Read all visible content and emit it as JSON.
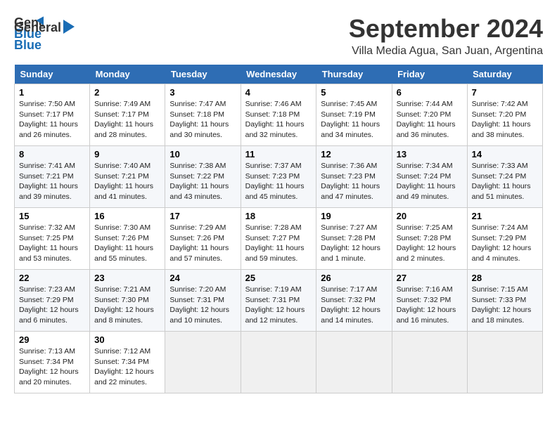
{
  "header": {
    "logo_general": "General",
    "logo_blue": "Blue",
    "month_title": "September 2024",
    "location": "Villa Media Agua, San Juan, Argentina"
  },
  "calendar": {
    "days_of_week": [
      "Sunday",
      "Monday",
      "Tuesday",
      "Wednesday",
      "Thursday",
      "Friday",
      "Saturday"
    ],
    "weeks": [
      [
        null,
        {
          "day": "2",
          "sunrise": "Sunrise: 7:49 AM",
          "sunset": "Sunset: 7:17 PM",
          "daylight": "Daylight: 11 hours and 28 minutes."
        },
        {
          "day": "3",
          "sunrise": "Sunrise: 7:47 AM",
          "sunset": "Sunset: 7:18 PM",
          "daylight": "Daylight: 11 hours and 30 minutes."
        },
        {
          "day": "4",
          "sunrise": "Sunrise: 7:46 AM",
          "sunset": "Sunset: 7:18 PM",
          "daylight": "Daylight: 11 hours and 32 minutes."
        },
        {
          "day": "5",
          "sunrise": "Sunrise: 7:45 AM",
          "sunset": "Sunset: 7:19 PM",
          "daylight": "Daylight: 11 hours and 34 minutes."
        },
        {
          "day": "6",
          "sunrise": "Sunrise: 7:44 AM",
          "sunset": "Sunset: 7:20 PM",
          "daylight": "Daylight: 11 hours and 36 minutes."
        },
        {
          "day": "7",
          "sunrise": "Sunrise: 7:42 AM",
          "sunset": "Sunset: 7:20 PM",
          "daylight": "Daylight: 11 hours and 38 minutes."
        }
      ],
      [
        {
          "day": "1",
          "sunrise": "Sunrise: 7:50 AM",
          "sunset": "Sunset: 7:17 PM",
          "daylight": "Daylight: 11 hours and 26 minutes."
        },
        null,
        null,
        null,
        null,
        null,
        null
      ],
      [
        {
          "day": "8",
          "sunrise": "Sunrise: 7:41 AM",
          "sunset": "Sunset: 7:21 PM",
          "daylight": "Daylight: 11 hours and 39 minutes."
        },
        {
          "day": "9",
          "sunrise": "Sunrise: 7:40 AM",
          "sunset": "Sunset: 7:21 PM",
          "daylight": "Daylight: 11 hours and 41 minutes."
        },
        {
          "day": "10",
          "sunrise": "Sunrise: 7:38 AM",
          "sunset": "Sunset: 7:22 PM",
          "daylight": "Daylight: 11 hours and 43 minutes."
        },
        {
          "day": "11",
          "sunrise": "Sunrise: 7:37 AM",
          "sunset": "Sunset: 7:23 PM",
          "daylight": "Daylight: 11 hours and 45 minutes."
        },
        {
          "day": "12",
          "sunrise": "Sunrise: 7:36 AM",
          "sunset": "Sunset: 7:23 PM",
          "daylight": "Daylight: 11 hours and 47 minutes."
        },
        {
          "day": "13",
          "sunrise": "Sunrise: 7:34 AM",
          "sunset": "Sunset: 7:24 PM",
          "daylight": "Daylight: 11 hours and 49 minutes."
        },
        {
          "day": "14",
          "sunrise": "Sunrise: 7:33 AM",
          "sunset": "Sunset: 7:24 PM",
          "daylight": "Daylight: 11 hours and 51 minutes."
        }
      ],
      [
        {
          "day": "15",
          "sunrise": "Sunrise: 7:32 AM",
          "sunset": "Sunset: 7:25 PM",
          "daylight": "Daylight: 11 hours and 53 minutes."
        },
        {
          "day": "16",
          "sunrise": "Sunrise: 7:30 AM",
          "sunset": "Sunset: 7:26 PM",
          "daylight": "Daylight: 11 hours and 55 minutes."
        },
        {
          "day": "17",
          "sunrise": "Sunrise: 7:29 AM",
          "sunset": "Sunset: 7:26 PM",
          "daylight": "Daylight: 11 hours and 57 minutes."
        },
        {
          "day": "18",
          "sunrise": "Sunrise: 7:28 AM",
          "sunset": "Sunset: 7:27 PM",
          "daylight": "Daylight: 11 hours and 59 minutes."
        },
        {
          "day": "19",
          "sunrise": "Sunrise: 7:27 AM",
          "sunset": "Sunset: 7:28 PM",
          "daylight": "Daylight: 12 hours and 1 minute."
        },
        {
          "day": "20",
          "sunrise": "Sunrise: 7:25 AM",
          "sunset": "Sunset: 7:28 PM",
          "daylight": "Daylight: 12 hours and 2 minutes."
        },
        {
          "day": "21",
          "sunrise": "Sunrise: 7:24 AM",
          "sunset": "Sunset: 7:29 PM",
          "daylight": "Daylight: 12 hours and 4 minutes."
        }
      ],
      [
        {
          "day": "22",
          "sunrise": "Sunrise: 7:23 AM",
          "sunset": "Sunset: 7:29 PM",
          "daylight": "Daylight: 12 hours and 6 minutes."
        },
        {
          "day": "23",
          "sunrise": "Sunrise: 7:21 AM",
          "sunset": "Sunset: 7:30 PM",
          "daylight": "Daylight: 12 hours and 8 minutes."
        },
        {
          "day": "24",
          "sunrise": "Sunrise: 7:20 AM",
          "sunset": "Sunset: 7:31 PM",
          "daylight": "Daylight: 12 hours and 10 minutes."
        },
        {
          "day": "25",
          "sunrise": "Sunrise: 7:19 AM",
          "sunset": "Sunset: 7:31 PM",
          "daylight": "Daylight: 12 hours and 12 minutes."
        },
        {
          "day": "26",
          "sunrise": "Sunrise: 7:17 AM",
          "sunset": "Sunset: 7:32 PM",
          "daylight": "Daylight: 12 hours and 14 minutes."
        },
        {
          "day": "27",
          "sunrise": "Sunrise: 7:16 AM",
          "sunset": "Sunset: 7:32 PM",
          "daylight": "Daylight: 12 hours and 16 minutes."
        },
        {
          "day": "28",
          "sunrise": "Sunrise: 7:15 AM",
          "sunset": "Sunset: 7:33 PM",
          "daylight": "Daylight: 12 hours and 18 minutes."
        }
      ],
      [
        {
          "day": "29",
          "sunrise": "Sunrise: 7:13 AM",
          "sunset": "Sunset: 7:34 PM",
          "daylight": "Daylight: 12 hours and 20 minutes."
        },
        {
          "day": "30",
          "sunrise": "Sunrise: 7:12 AM",
          "sunset": "Sunset: 7:34 PM",
          "daylight": "Daylight: 12 hours and 22 minutes."
        },
        null,
        null,
        null,
        null,
        null
      ]
    ]
  }
}
